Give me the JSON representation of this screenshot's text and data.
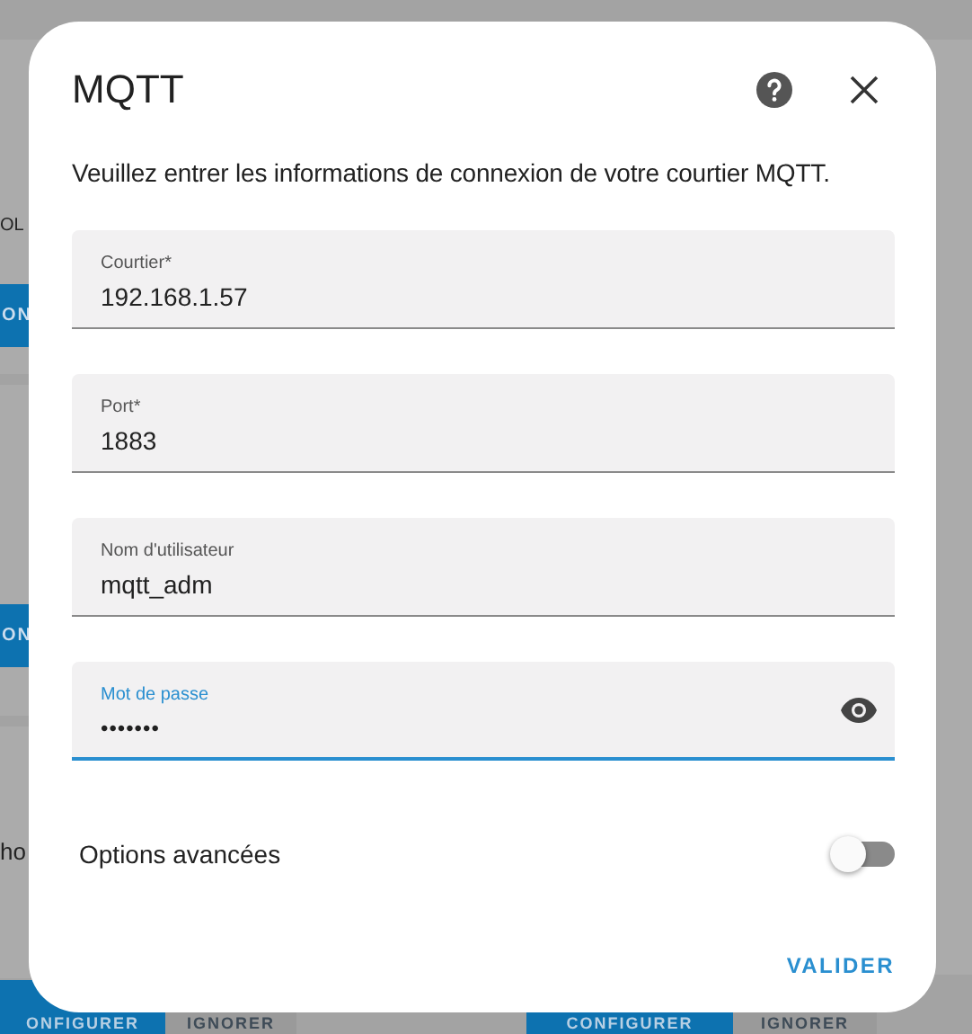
{
  "background": {
    "left_cards": [
      {
        "text": "OL",
        "button": "ON"
      },
      {
        "button": "ON"
      },
      {
        "text": "ho"
      }
    ],
    "bottom_buttons": [
      {
        "label": "ONFIGURER",
        "kind": "primary"
      },
      {
        "label": "IGNORER",
        "kind": "secondary"
      },
      {
        "label": "CONFIGURER",
        "kind": "primary"
      },
      {
        "label": "IGNORER",
        "kind": "secondary"
      }
    ]
  },
  "dialog": {
    "title": "MQTT",
    "description": "Veuillez entrer les informations de connexion de votre courtier MQTT.",
    "fields": [
      {
        "label": "Courtier*",
        "value": "192.168.1.57",
        "kind": "text",
        "focused": false
      },
      {
        "label": "Port*",
        "value": "1883",
        "kind": "text",
        "focused": false
      },
      {
        "label": "Nom d'utilisateur",
        "value": "mqtt_adm",
        "kind": "text",
        "focused": false
      },
      {
        "label": "Mot de passe",
        "value": "•••••••",
        "kind": "password",
        "focused": true
      }
    ],
    "advanced": {
      "label": "Options avancées",
      "on": false
    },
    "submit": "VALIDER"
  }
}
